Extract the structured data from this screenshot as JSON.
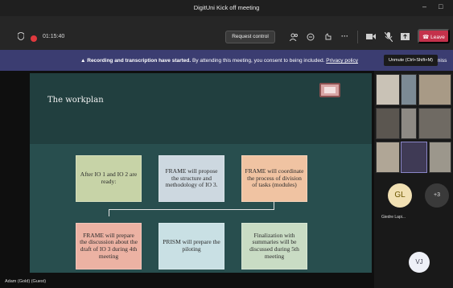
{
  "window": {
    "title": "DigitUni Kick off meeting",
    "minimize_glyph": "–",
    "maximize_glyph": "□"
  },
  "toolbar": {
    "timer": "01:15:40",
    "request_control_label": "Request control",
    "leave_label": "Leave",
    "more_glyph": "···",
    "icons": [
      "shield-icon",
      "record-icon",
      "participants-icon",
      "chat-icon",
      "reactions-icon",
      "more-icon",
      "camera-icon",
      "mic-off-icon",
      "share-icon",
      "phone-icon"
    ]
  },
  "banner": {
    "icon_glyph": "▲",
    "bold_text": "Recording and transcription have started.",
    "text": "By attending this meeting, you consent to being included.",
    "link_text": "Privacy policy",
    "dismiss_fragment": "miss"
  },
  "tooltip": {
    "text": "Unmute (Ctrl+Shift+M)"
  },
  "slide": {
    "title": "The workplan",
    "boxes": [
      {
        "text": "After IO 1 and IO 2 are ready:"
      },
      {
        "text": "FRAME will propose the structure and methodology of IO 3."
      },
      {
        "text": "FRAME will coordinate the process of division of tasks (modules)"
      },
      {
        "text": "FRAME will prepare the discussion about the draft of IO 3 during 4th meeting"
      },
      {
        "text": "PRISM will prepare the piloting"
      },
      {
        "text": "Finalization with summaries will be discussed during 5th meeting"
      }
    ]
  },
  "presenter_caption": "Adam (Gold) (Guest)",
  "participants": {
    "gl_initials": "GL",
    "gl_name": "Giedre Lapi...",
    "more_count": "+3",
    "vj_initials": "VJ"
  },
  "colors": {
    "leave": "#c4314b",
    "banner": "#3b3d71",
    "slide_bg": "#284e4e"
  }
}
